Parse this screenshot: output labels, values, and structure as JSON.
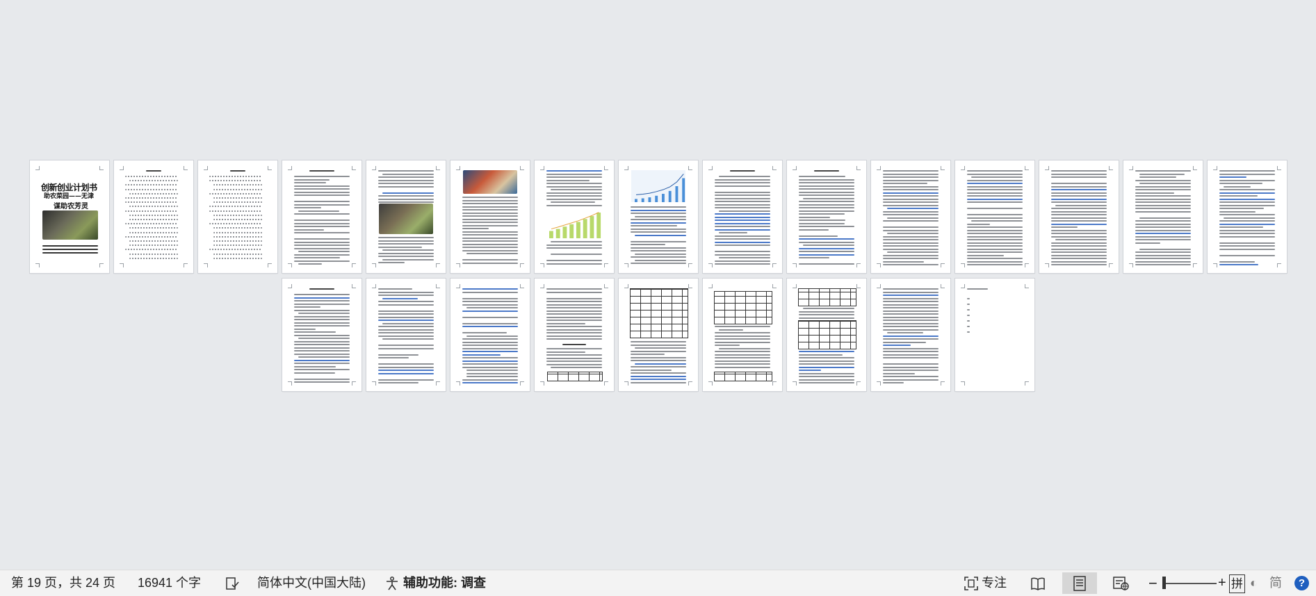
{
  "document": {
    "cover_title": "创新创业计划书",
    "cover_subtitle": "助农菜园——无津",
    "cover_subtitle2": "谋助农芳灵"
  },
  "statusbar": {
    "page_info": "第 19 页，共 24 页",
    "word_count": "16941 个字",
    "track_changes_icon": "document-check-icon",
    "language": "简体中文(中国大陆)",
    "accessibility_icon": "accessibility-person-icon",
    "accessibility": "辅助功能: 调查",
    "focus_icon": "focus-icon",
    "focus": "专注",
    "read_mode_icon": "book-icon",
    "print_layout_icon": "page-layout-icon",
    "web_layout_icon": "web-layout-icon",
    "zoom_out": "−",
    "zoom_in": "+",
    "ime_mode": "拼",
    "ime_halfwidth": "◐",
    "ime_simplified": "简",
    "help_icon": "help-icon",
    "help": "?"
  },
  "colors": {
    "canvas": "#e7e9ec",
    "statusbar": "#f3f3f3",
    "highlight_text": "#4a78c8",
    "help_badge": "#1f5fbf"
  }
}
